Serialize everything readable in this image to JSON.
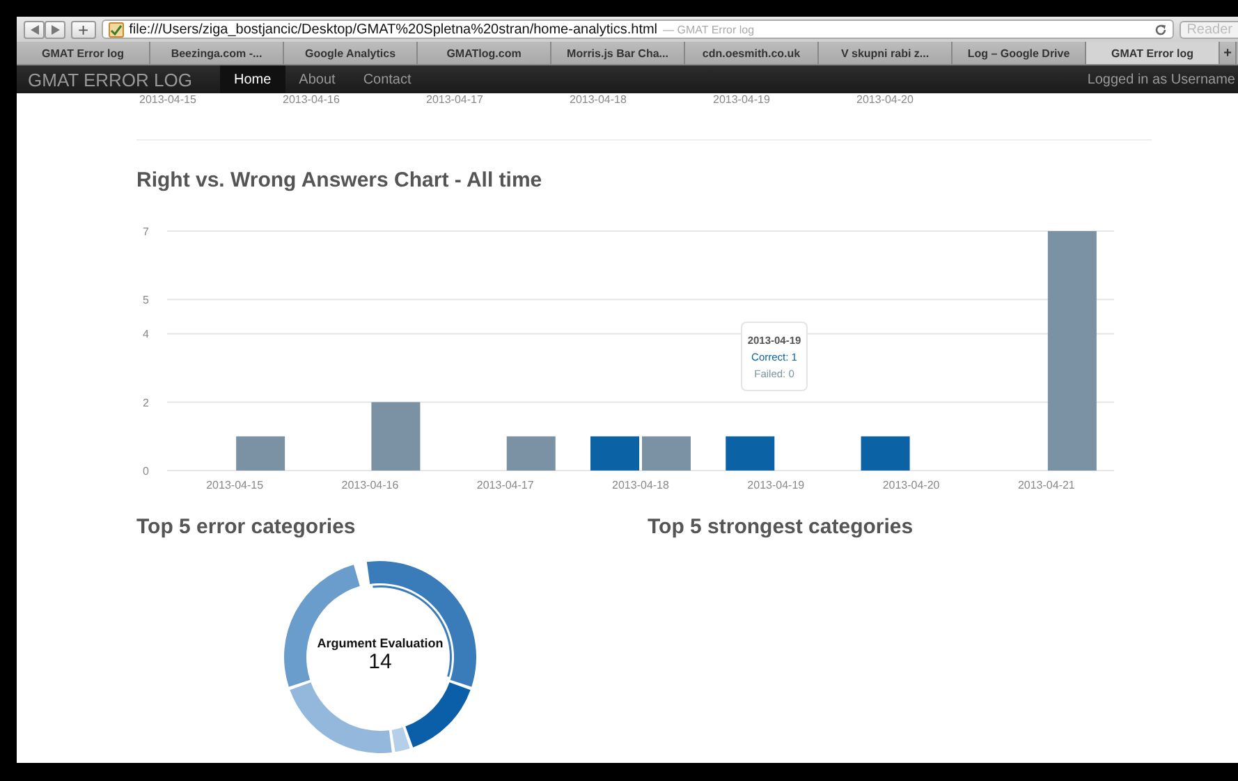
{
  "browser": {
    "url": "file:///Users/ziga_bostjancic/Desktop/GMAT%20Spletna%20stran/home-analytics.html",
    "page_title": "— GMAT Error log",
    "reader": "Reader",
    "new_tab": "+",
    "tabs": [
      {
        "label": "GMAT Error log",
        "selected": false
      },
      {
        "label": "Beezinga.com -...",
        "selected": false
      },
      {
        "label": "Google Analytics",
        "selected": false
      },
      {
        "label": "GMATlog.com",
        "selected": false
      },
      {
        "label": "Morris.js Bar Cha...",
        "selected": false
      },
      {
        "label": "cdn.oesmith.co.uk",
        "selected": false
      },
      {
        "label": "V skupni rabi z...",
        "selected": false
      },
      {
        "label": "Log – Google Drive",
        "selected": false
      },
      {
        "label": "GMAT Error log",
        "selected": true
      }
    ]
  },
  "navbar": {
    "brand": "GMAT ERROR LOG",
    "items": [
      {
        "label": "Home",
        "selected": true
      },
      {
        "label": "About",
        "selected": false
      },
      {
        "label": "Contact",
        "selected": false
      }
    ],
    "user": "Logged in as Username"
  },
  "previous_chart_labels": [
    "2013-04-15",
    "2013-04-16",
    "2013-04-17",
    "2013-04-18",
    "2013-04-19",
    "2013-04-20"
  ],
  "answers_chart": {
    "heading": "Right vs. Wrong Answers Chart - All time",
    "chart_data": {
      "type": "bar",
      "categories": [
        "2013-04-15",
        "2013-04-16",
        "2013-04-17",
        "2013-04-18",
        "2013-04-19",
        "2013-04-20",
        "2013-04-21"
      ],
      "series": [
        {
          "color": "#0b62a4",
          "values": [
            0,
            0,
            0,
            1,
            1,
            1,
            0
          ]
        },
        {
          "color": "#7a92a3",
          "values": [
            1,
            2,
            1,
            1,
            0,
            0,
            7
          ]
        }
      ],
      "grid": true,
      "ylim": [
        0,
        7
      ],
      "yticks": [
        0,
        2,
        4,
        5,
        7
      ]
    },
    "tooltip": {
      "title": "2013-04-19",
      "lines": [
        {
          "text": "Correct: 1",
          "color": "#0b62a4"
        },
        {
          "text": "Failed: 0",
          "color": "#7a92a3"
        }
      ]
    }
  },
  "error_categories": {
    "heading": "Top 5 error categories",
    "donut_label": "Argument Evaluation",
    "donut_value": "14"
  },
  "strongest_categories": {
    "heading": "Top 5 strongest categories"
  }
}
